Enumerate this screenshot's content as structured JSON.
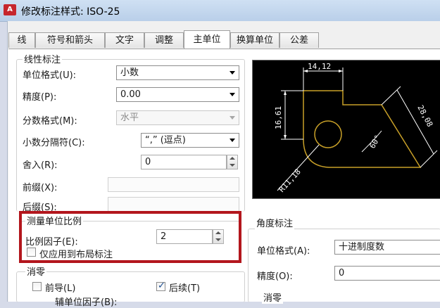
{
  "window": {
    "app_icon": "A",
    "title": "修改标注样式: ISO-25"
  },
  "tabs": [
    {
      "label": "线"
    },
    {
      "label": "符号和箭头"
    },
    {
      "label": "文字"
    },
    {
      "label": "调整"
    },
    {
      "label": "主单位",
      "active": true
    },
    {
      "label": "换算单位"
    },
    {
      "label": "公差"
    }
  ],
  "linear": {
    "group_title": "线性标注",
    "unit_format": {
      "label": "单位格式(U):",
      "value": "小数"
    },
    "precision": {
      "label": "精度(P):",
      "value": "0.00"
    },
    "fraction_format": {
      "label": "分数格式(M):",
      "value": "水平"
    },
    "decimal_separator": {
      "label": "小数分隔符(C):",
      "value": "“,” (逗点)"
    },
    "round_off": {
      "label": "舍入(R):",
      "value": "0"
    },
    "prefix": {
      "label": "前缀(X):",
      "value": ""
    },
    "suffix": {
      "label": "后缀(S):",
      "value": ""
    }
  },
  "measurement_scale": {
    "group_title": "测量单位比例",
    "scale_factor": {
      "label": "比例因子(E):",
      "value": "2"
    },
    "apply_layout": {
      "label": "仅应用到布局标注",
      "checked": false
    }
  },
  "zero_suppression": {
    "group_title": "消零",
    "leading": {
      "label": "前导(L)",
      "checked": false
    },
    "trailing": {
      "label": "后续(T)",
      "checked": true
    },
    "sub_unit_factor": {
      "label": "辅单位因子(B):"
    }
  },
  "angular": {
    "group_title": "角度标注",
    "unit_format": {
      "label": "单位格式(A):",
      "value": "十进制度数"
    },
    "precision": {
      "label": "精度(O):",
      "value": "0"
    },
    "zero_group_title": "消零"
  },
  "preview": {
    "dim_top": "14,12",
    "dim_left": "16,61",
    "dim_right": "28,08",
    "dim_angle": "60°",
    "dim_radius": "R11,18"
  },
  "colors": {
    "highlight": "#b3161d",
    "preview_bg": "#000000",
    "geometry": "#c8a028",
    "dimension": "#ffffff"
  }
}
